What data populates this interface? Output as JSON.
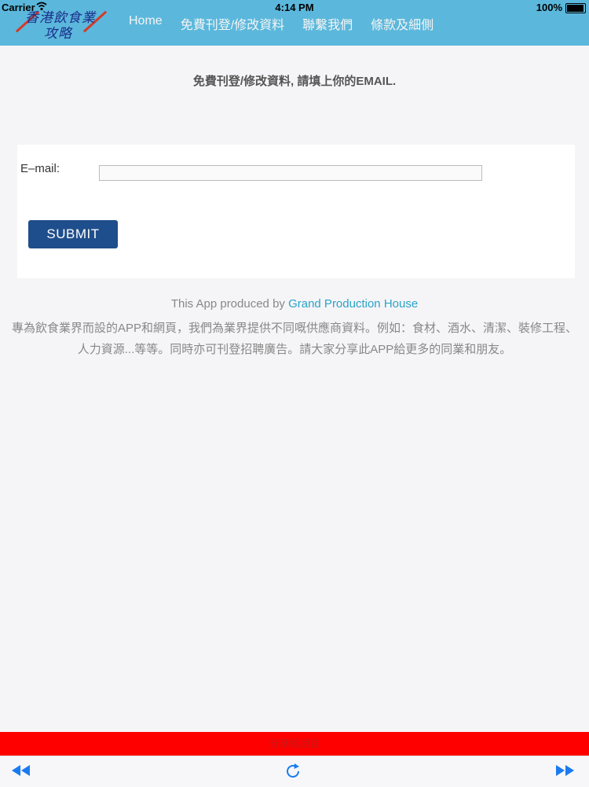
{
  "status_bar": {
    "carrier": "Carrier",
    "time": "4:14 PM",
    "battery": "100%"
  },
  "logo": {
    "line1": "香港飲食業",
    "line2": "攻略"
  },
  "nav": {
    "items": [
      "Home",
      "免費刊登/修改資料",
      "聯繫我們",
      "條款及細側"
    ]
  },
  "page": {
    "heading": "免費刊登/修改資料, 請填上你的EMAIL.",
    "email_label": "E–mail:",
    "email_value": "",
    "submit_label": "SUBMIT",
    "credit_prefix": "This App produced by ",
    "credit_link": "Grand Production House",
    "description": "專為飲食業界而設的APP和網頁，我們為業界提供不同嘅供應商資料。例如：食材、酒水、清潔、裝修工程、人力資源...等等。同時亦可刊登招聘廣告。請大家分享此APP給更多的同業和朋友。"
  },
  "bottom": {
    "red_bar_text": "分享給朋友"
  },
  "colors": {
    "header": "#5bb8dc",
    "submit": "#1f4e8c",
    "link": "#2aa3c9",
    "red_bar": "#ff0000",
    "toolbar_icons": "#1a7bf0"
  },
  "icons": {
    "back": "rewind-icon",
    "reload": "reload-icon",
    "forward": "fast-forward-icon",
    "wifi": "wifi-icon",
    "battery": "battery-icon"
  }
}
